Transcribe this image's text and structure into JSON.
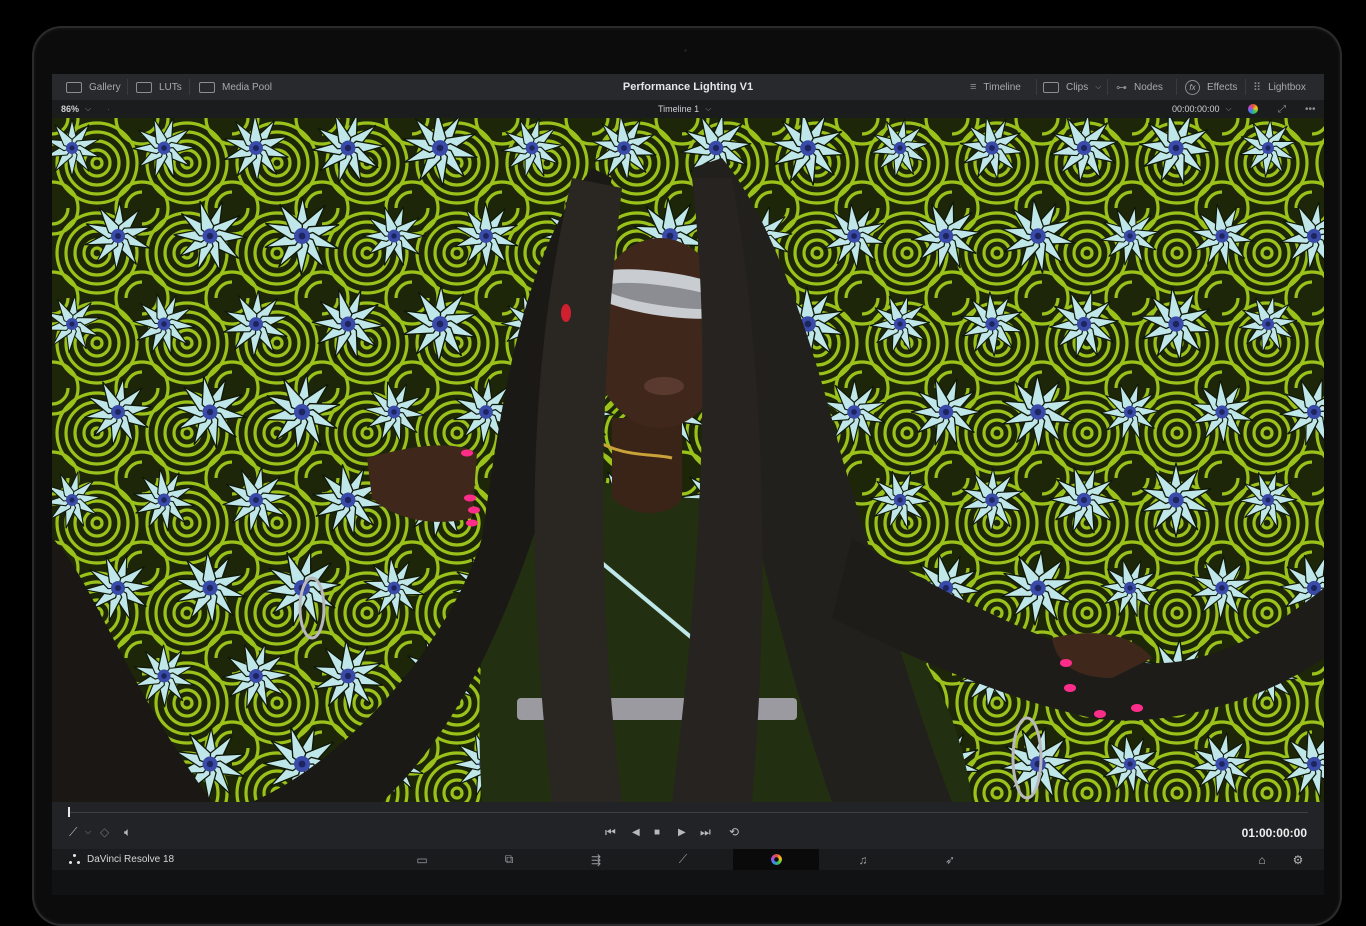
{
  "top_bar": {
    "left_items": [
      {
        "label": "Gallery",
        "icon": "gallery-icon"
      },
      {
        "label": "LUTs",
        "icon": "luts-icon"
      },
      {
        "label": "Media Pool",
        "icon": "media-pool-icon"
      }
    ],
    "title": "Performance Lighting V1",
    "right_items": [
      {
        "label": "Timeline",
        "icon": "timeline-icon"
      },
      {
        "label": "Clips",
        "icon": "clips-icon"
      },
      {
        "label": "Nodes",
        "icon": "nodes-icon"
      },
      {
        "label": "Effects",
        "icon": "fx-icon"
      },
      {
        "label": "Lightbox",
        "icon": "lightbox-icon"
      }
    ]
  },
  "viewer_bar": {
    "zoom": "86%",
    "timeline_name": "Timeline 1",
    "source_timecode": "00:00:00:00"
  },
  "transport": {
    "timecode": "01:00:00:00",
    "playhead_fraction": 0.0
  },
  "page_bar": {
    "app_name": "DaVinci Resolve 18",
    "pages": [
      "media-page-icon",
      "cut-page-icon",
      "edit-page-icon",
      "fusion-page-icon",
      "color-page-icon",
      "fairlight-page-icon",
      "deliver-page-icon"
    ],
    "active_page": "color-page-icon"
  },
  "colors": {
    "accent": "#e64b3c",
    "background_pattern": "#9bc21a",
    "flower": "#b8e4e6",
    "nail_polish": "#ff2d8a"
  }
}
